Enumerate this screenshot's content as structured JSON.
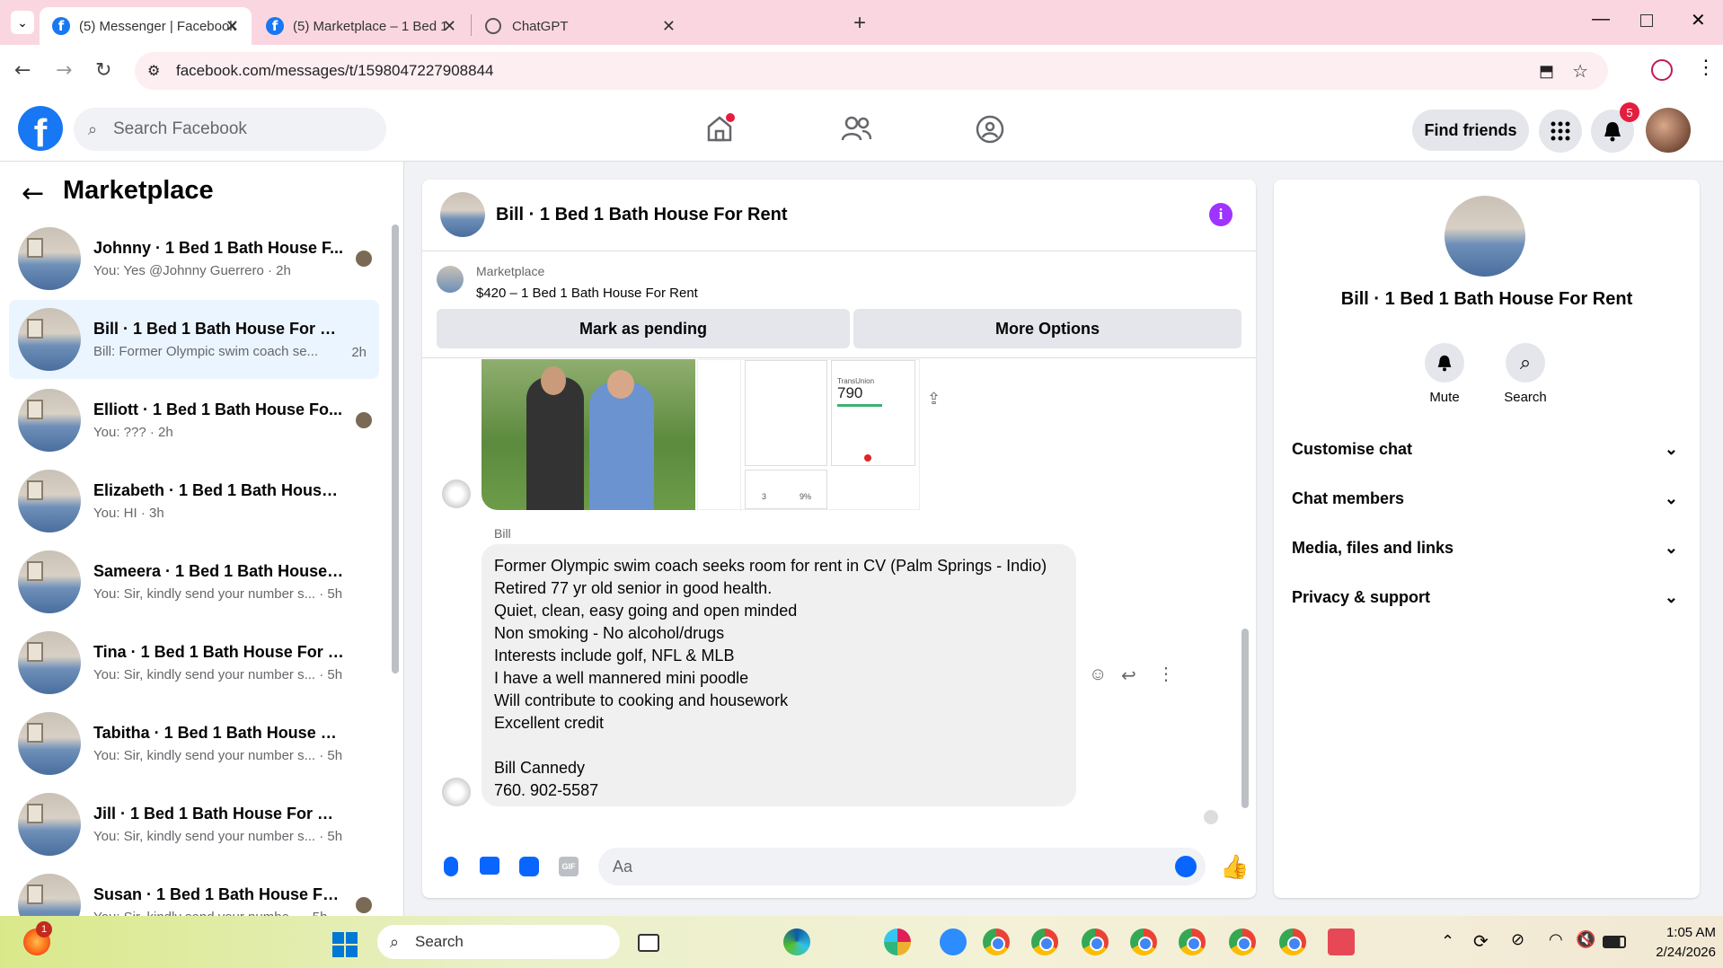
{
  "browser": {
    "tabs": [
      {
        "title": "(5) Messenger | Facebook"
      },
      {
        "title": "(5) Marketplace – 1 Bed 1 Bath"
      },
      {
        "title": "ChatGPT"
      }
    ],
    "url": "facebook.com/messages/t/1598047227908844"
  },
  "fb": {
    "search_placeholder": "Search Facebook",
    "find_friends": "Find friends",
    "notif_count": "5"
  },
  "sidebar": {
    "title": "Marketplace",
    "conversations": [
      {
        "name": "Johnny · 1 Bed 1 Bath House F...",
        "preview": "You: Yes @Johnny Guerrero · 2h"
      },
      {
        "name": "Bill · 1 Bed 1 Bath House For Rent",
        "preview": "Bill: Former Olympic swim coach se...",
        "time": "2h"
      },
      {
        "name": "Elliott · 1 Bed 1 Bath House Fo...",
        "preview": "You: ??? · 2h"
      },
      {
        "name": "Elizabeth · 1 Bed 1 Bath House F...",
        "preview": "You: HI · 3h"
      },
      {
        "name": "Sameera · 1 Bed 1 Bath House Fo...",
        "preview": "You: Sir, kindly send your number s... · 5h"
      },
      {
        "name": "Tina · 1 Bed 1 Bath House For Rent",
        "preview": "You: Sir, kindly send your number s... · 5h"
      },
      {
        "name": "Tabitha · 1 Bed 1 Bath House For...",
        "preview": "You: Sir, kindly send your number s... · 5h"
      },
      {
        "name": "Jill · 1 Bed 1 Bath House For Rent",
        "preview": "You: Sir, kindly send your number s... · 5h"
      },
      {
        "name": "Susan · 1 Bed 1 Bath House Fo...",
        "preview": "You: Sir, kindly send your numbe... · 5h"
      }
    ]
  },
  "chat": {
    "title": "Bill · 1 Bed 1 Bath House For Rent",
    "listing_source": "Marketplace",
    "listing_title": "$420 – 1 Bed 1 Bath House For Rent",
    "mark_pending": "Mark as pending",
    "more_options": "More Options",
    "screenshot_score": "790",
    "screenshot_label": "TransUnion",
    "screenshot_stat1": "3",
    "screenshot_stat2": "9%",
    "sender": "Bill",
    "message": "Former Olympic swim coach seeks room for rent in CV (Palm Springs - Indio)\nRetired 77 yr old senior in good health.\nQuiet, clean, easy going and open minded\nNon smoking - No alcohol/drugs\nInterests include golf, NFL & MLB\nI have a well mannered mini poodle\nWill contribute to cooking and housework\nExcellent credit\n\nBill Cannedy\n760. 902-5587",
    "composer_placeholder": "Aa"
  },
  "panel": {
    "title": "Bill · 1 Bed 1 Bath House For Rent",
    "mute": "Mute",
    "search": "Search",
    "sections": [
      "Customise chat",
      "Chat members",
      "Media, files and links",
      "Privacy & support"
    ]
  },
  "taskbar": {
    "search": "Search",
    "time": "1:05 AM",
    "date": "2/24/2026",
    "badge": "1"
  }
}
